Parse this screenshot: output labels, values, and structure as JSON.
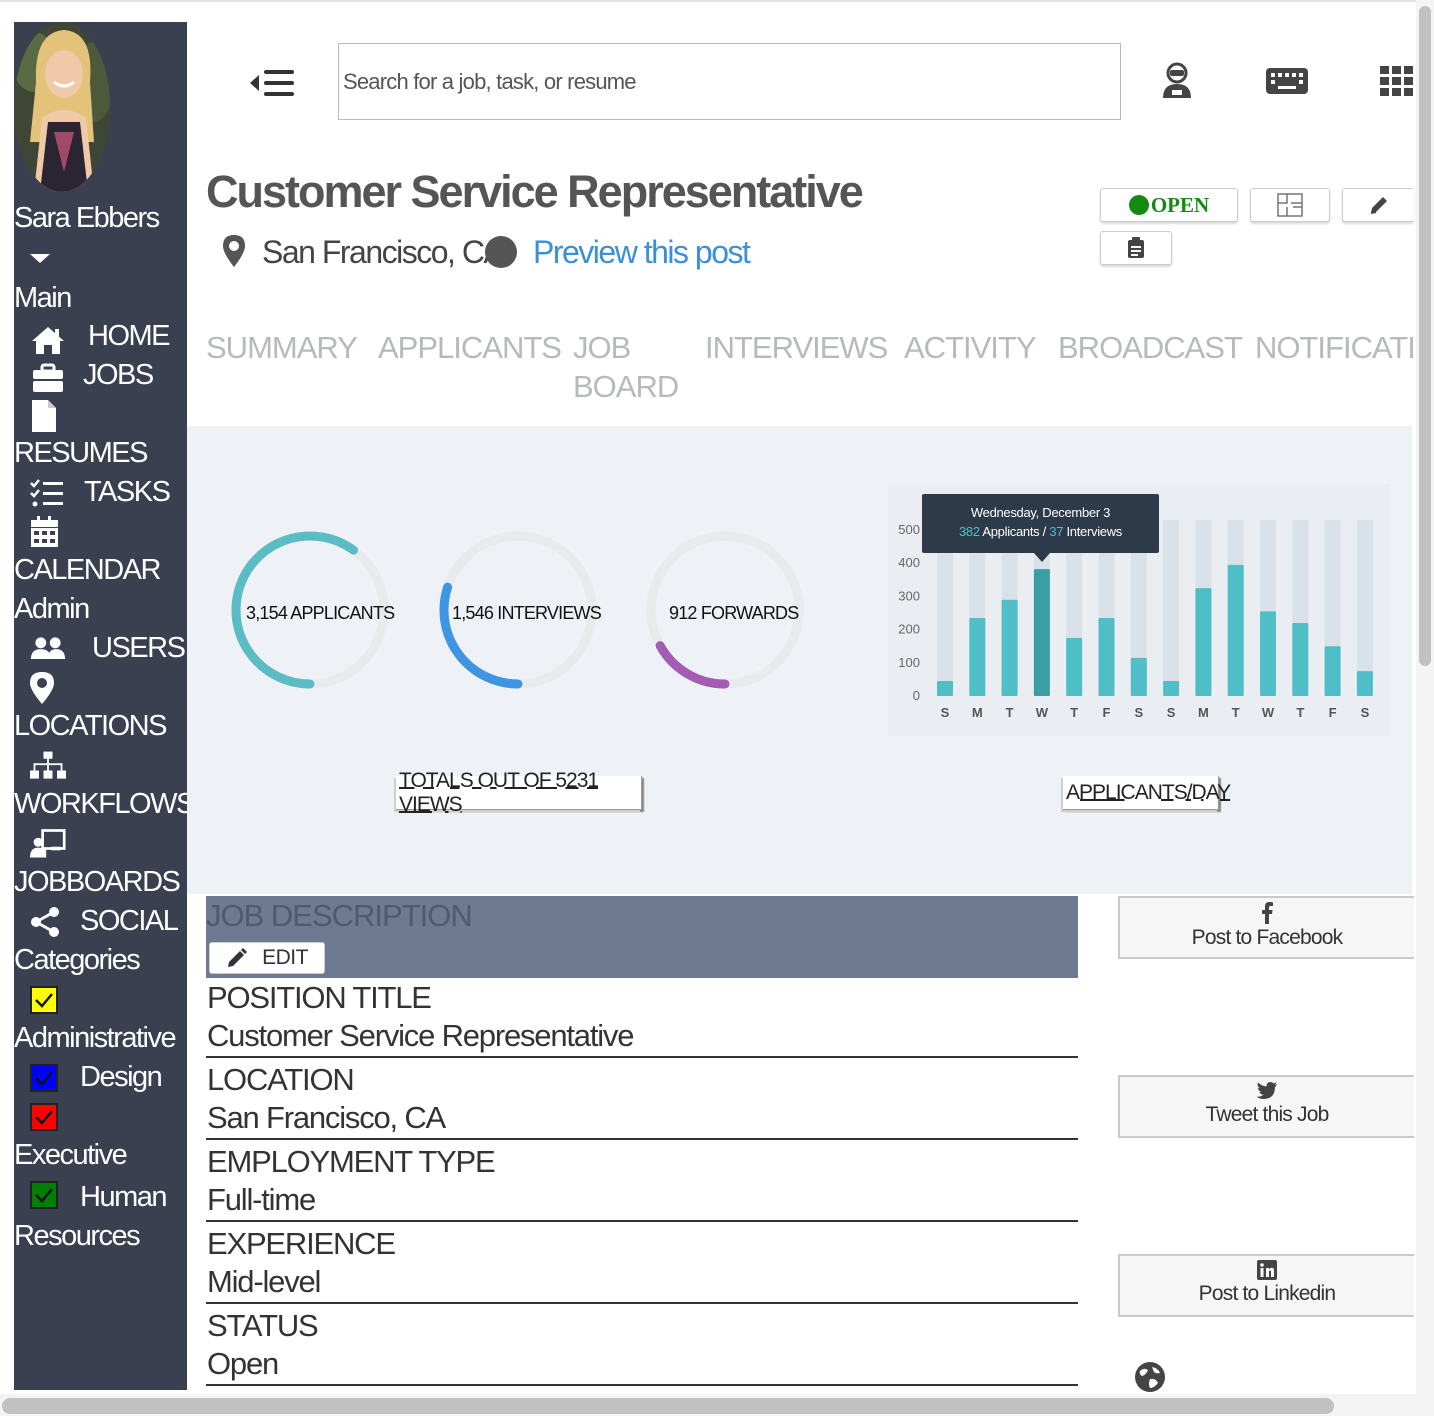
{
  "user": {
    "name": "Sara Ebbers"
  },
  "search": {
    "placeholder": "Search for a job, task, or resume"
  },
  "sidebar": {
    "main_heading": "Main",
    "admin_heading": "Admin",
    "categories_heading": "Categories",
    "main_items": [
      {
        "label": "HOME",
        "icon": "home-icon"
      },
      {
        "label": "JOBS",
        "icon": "briefcase-icon"
      },
      {
        "label": "RESUMES",
        "icon": "file-icon"
      },
      {
        "label": "TASKS",
        "icon": "tasks-icon"
      },
      {
        "label": "CALENDAR",
        "icon": "calendar-icon"
      }
    ],
    "admin_items": [
      {
        "label": "USERS",
        "icon": "users-icon"
      },
      {
        "label": "LOCATIONS",
        "icon": "map-marker-icon"
      },
      {
        "label": "WORKFLOWS",
        "icon": "sitemap-icon"
      },
      {
        "label": "JOBBOARDS",
        "icon": "chalkboard-teacher-icon"
      },
      {
        "label": "SOCIAL",
        "icon": "share-icon"
      }
    ],
    "categories": [
      {
        "label": "Administrative",
        "color": "#ffff00"
      },
      {
        "label": "Design",
        "color": "#0000ff"
      },
      {
        "label": "Executive",
        "color": "#ff0000"
      },
      {
        "label": "Human Resources",
        "color": "#008000"
      }
    ]
  },
  "job": {
    "title": "Customer Service Representative",
    "location": "San Francisco, CA",
    "preview_link": "Preview this post",
    "status_badge": "OPEN",
    "status_color": "#148a14"
  },
  "tabs": [
    "SUMMARY",
    "APPLICANTS",
    "JOB BOARD",
    "INTERVIEWS",
    "ACTIVITY",
    "BROADCAST",
    "NOTIFICATIO"
  ],
  "stats": {
    "rings": [
      {
        "label": "3,154 APPLICANTS",
        "fraction": 0.6,
        "color": "#5bbcc4"
      },
      {
        "label": "1,546 INTERVIEWS",
        "fraction": 0.3,
        "color": "#3d95e3"
      },
      {
        "label": "912 FORWARDS",
        "fraction": 0.17,
        "color": "#a35bb3"
      }
    ],
    "totals_caption": "TOTALS OUT OF 5231 VIEWS",
    "chart_caption": "APPLICANTS/DAY"
  },
  "chart_data": {
    "type": "bar",
    "title": "",
    "categories": [
      "S",
      "M",
      "T",
      "W",
      "T",
      "F",
      "S",
      "S",
      "M",
      "T",
      "W",
      "T",
      "F",
      "S"
    ],
    "series": [
      {
        "name": "Applicants",
        "values": [
          45,
          235,
          290,
          382,
          175,
          235,
          115,
          45,
          325,
          395,
          255,
          220,
          150,
          75
        ]
      }
    ],
    "background_max": 530,
    "ylim": [
      0,
      500
    ],
    "yticks": [
      "0",
      "100",
      "200",
      "300",
      "400",
      "500"
    ],
    "highlight_index": 3,
    "grid": false,
    "bar_color": "#4fbec7",
    "highlight_color": "#3a9ea5",
    "track_color": "#d9e2e8",
    "tooltip": {
      "date": "Wednesday, December 3",
      "applicants_num": "382",
      "applicants_label": "Applicants /",
      "interviews_num": "37",
      "interviews_label": "Interviews"
    }
  },
  "job_description": {
    "heading": "JOB DESCRIPTION",
    "edit_label": "EDIT",
    "fields": [
      {
        "label": "POSITION TITLE",
        "value": "Customer Service Representative"
      },
      {
        "label": "LOCATION",
        "value": "San Francisco, CA"
      },
      {
        "label": "EMPLOYMENT TYPE",
        "value": "Full-time"
      },
      {
        "label": "EXPERIENCE",
        "value": "Mid-level"
      },
      {
        "label": "STATUS",
        "value": "Open"
      }
    ]
  },
  "social": [
    {
      "label": "Post to Facebook",
      "icon": "facebook-icon"
    },
    {
      "label": "Tweet this Job",
      "icon": "twitter-icon"
    },
    {
      "label": "Post to Linkedin",
      "icon": "linkedin-icon"
    }
  ]
}
